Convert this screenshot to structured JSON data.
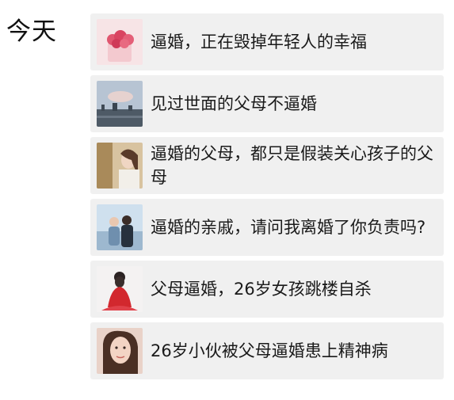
{
  "section": {
    "date_label": "今天"
  },
  "articles": [
    {
      "title": "逼婚，正在毁掉年轻人的幸福",
      "thumb": "flower-bouquet-image"
    },
    {
      "title": "见过世面的父母不逼婚",
      "thumb": "city-skyline-image"
    },
    {
      "title": "逼婚的父母，都只是假装关心孩子的父母",
      "thumb": "woman-portrait-image"
    },
    {
      "title": "逼婚的亲戚，请问我离婚了你负责吗?",
      "thumb": "couple-image"
    },
    {
      "title": "父母逼婚，26岁女孩跳楼自杀",
      "thumb": "girl-red-dress-image"
    },
    {
      "title": "26岁小伙被父母逼婚患上精神病",
      "thumb": "woman-face-image"
    }
  ]
}
